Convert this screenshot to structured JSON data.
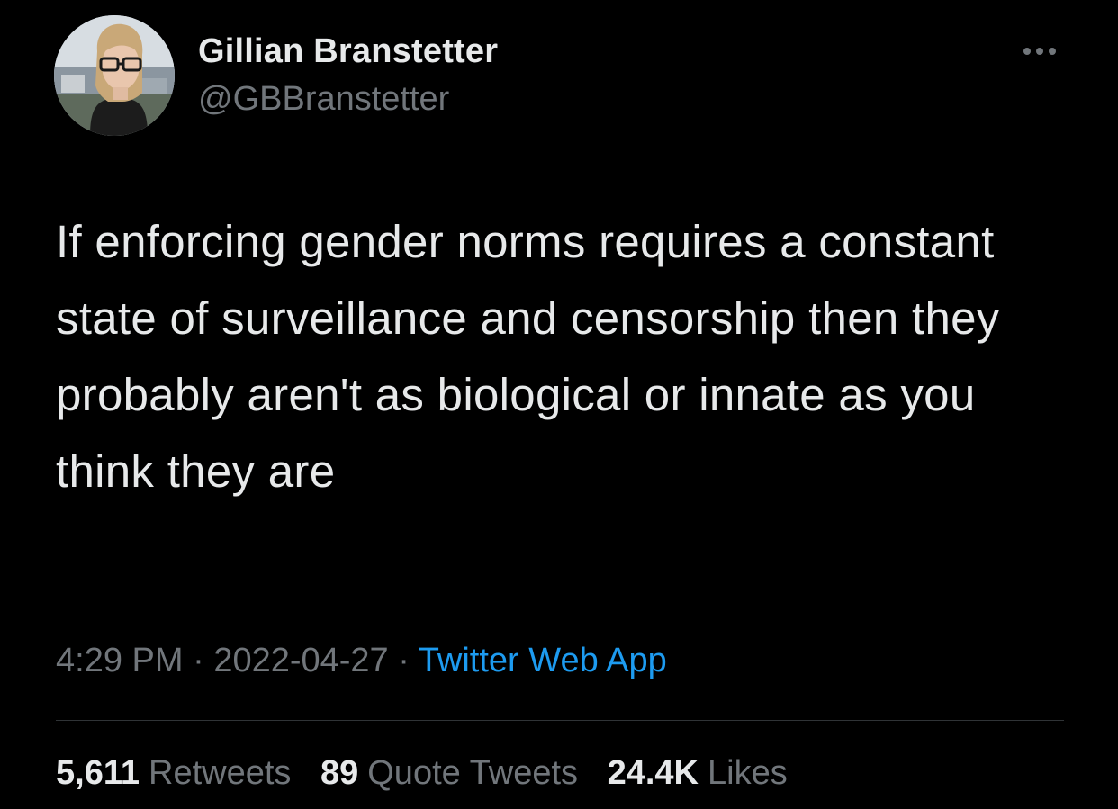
{
  "author": {
    "name": "Gillian Branstetter",
    "handle": "@GBBranstetter"
  },
  "tweet": {
    "text": "If enforcing gender norms requires a constant state of surveillance and censorship then they probably aren't as biological or innate as you think they are",
    "time": "4:29 PM",
    "date": "2022-04-27",
    "separator": "·",
    "source": "Twitter Web App"
  },
  "stats": {
    "retweets_count": "5,611",
    "retweets_label": "Retweets",
    "quotes_count": "89",
    "quotes_label": "Quote Tweets",
    "likes_count": "24.4K",
    "likes_label": "Likes"
  },
  "icons": {
    "more": "more-horizontal-icon"
  },
  "colors": {
    "background": "#000000",
    "primary_text": "#e7e9ea",
    "secondary_text": "#71767b",
    "link": "#1d9bf0",
    "divider": "#2f3336"
  }
}
